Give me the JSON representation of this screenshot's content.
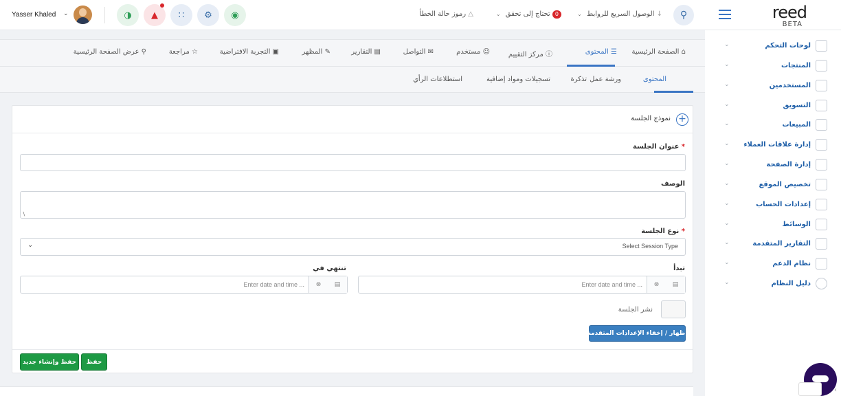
{
  "header": {
    "logo_text": "reed",
    "beta_label": "BETA",
    "quick_links_label": "الوصول السريع للروابط",
    "needs_check_label": "تحتاج إلى تحقق",
    "needs_check_count": "0",
    "error_codes_label": "رموز حالة الخطأ",
    "username": "Yasser Khaled"
  },
  "sidebar": {
    "items": [
      {
        "label": "لوحات التحكم"
      },
      {
        "label": "المنتجات"
      },
      {
        "label": "المستخدمين"
      },
      {
        "label": "التسويق"
      },
      {
        "label": "المبيعات"
      },
      {
        "label": "إدارة علاقات العملاء"
      },
      {
        "label": "إدارة الصفحة"
      },
      {
        "label": "تخصيص الموقع"
      },
      {
        "label": "إعدادات الحساب"
      },
      {
        "label": "الوسائط"
      },
      {
        "label": "التقارير المتقدمة"
      },
      {
        "label": "نظام الدعم"
      },
      {
        "label": "دليل النظام"
      }
    ]
  },
  "tabs_primary": [
    {
      "label": "الصفحة الرئيسية"
    },
    {
      "label": "المحتوى"
    },
    {
      "label": "مركز التقييم"
    },
    {
      "label": "مستخدم"
    },
    {
      "label": "التواصل"
    },
    {
      "label": "التقارير"
    },
    {
      "label": "المظهر"
    },
    {
      "label": "التجربة الافتراضية"
    },
    {
      "label": "مراجعة"
    },
    {
      "label": "عرض الصفحة الرئيسية"
    }
  ],
  "tabs_secondary": [
    {
      "label": "المحتوى"
    },
    {
      "label": "ورشة عمل"
    },
    {
      "label": "تذكرة"
    },
    {
      "label": "تسجيلات ومواد إضافية"
    },
    {
      "label": "استطلاعات الرأي"
    }
  ],
  "form": {
    "card_title": "نموذج الجلسة",
    "session_title_label": "عنوان الجلسة",
    "description_label": "الوصف",
    "session_type_label": "نوع الجلسة",
    "session_type_value": "Select Session Type",
    "start_label": "تبدأ",
    "end_label": "تنتهي في",
    "date_placeholder": "Enter date and time ...",
    "publish_label": "نشر الجلسة",
    "advanced_button": "إظهار / إخفاء الإعدادات المتقدمة",
    "save_button": "حفظ",
    "save_new_button": "حفظ وإنشاء جديد",
    "required_mark": "*"
  },
  "colors": {
    "accent": "#3a75c4",
    "save_green": "#1e9a44",
    "alert_red": "#d8262b"
  }
}
